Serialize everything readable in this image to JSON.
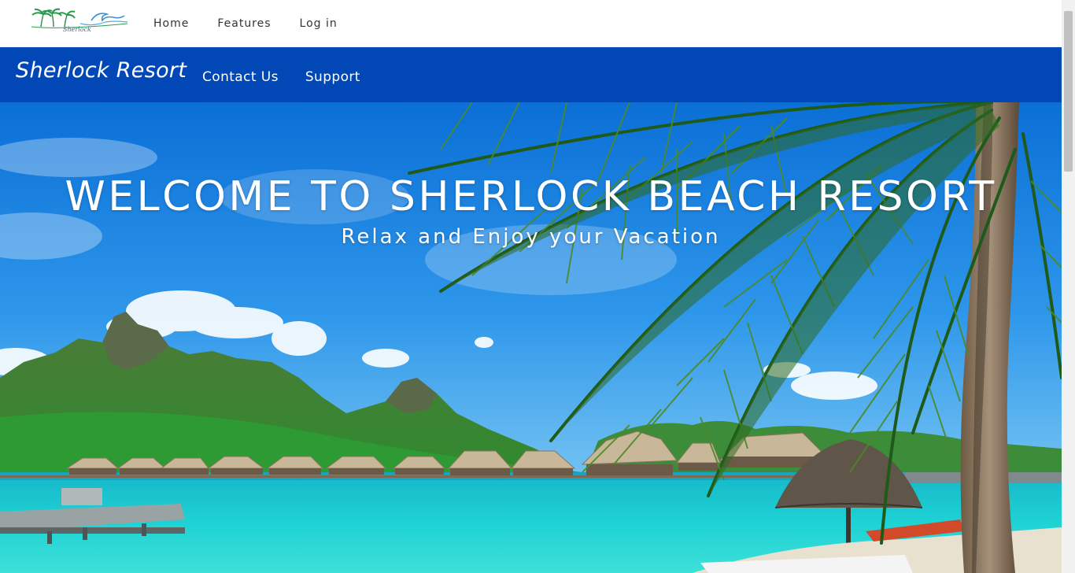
{
  "logo": {
    "text": "Sherlock",
    "icon": "palm-trees-wave-logo"
  },
  "topnav": {
    "items": [
      {
        "label": "Home"
      },
      {
        "label": "Features"
      },
      {
        "label": "Log in"
      }
    ]
  },
  "bluebar": {
    "brand": "Sherlock Resort",
    "items": [
      {
        "label": "Contact Us"
      },
      {
        "label": "Support"
      }
    ]
  },
  "hero": {
    "title": "WELCOME TO SHERLOCK BEACH RESORT",
    "subtitle": "Relax and Enjoy your Vacation",
    "image": "tropical-beach-overwater-bungalows-photo"
  },
  "colors": {
    "nav_blue": "#0247b6",
    "white": "#ffffff",
    "nav_text": "#333333"
  }
}
